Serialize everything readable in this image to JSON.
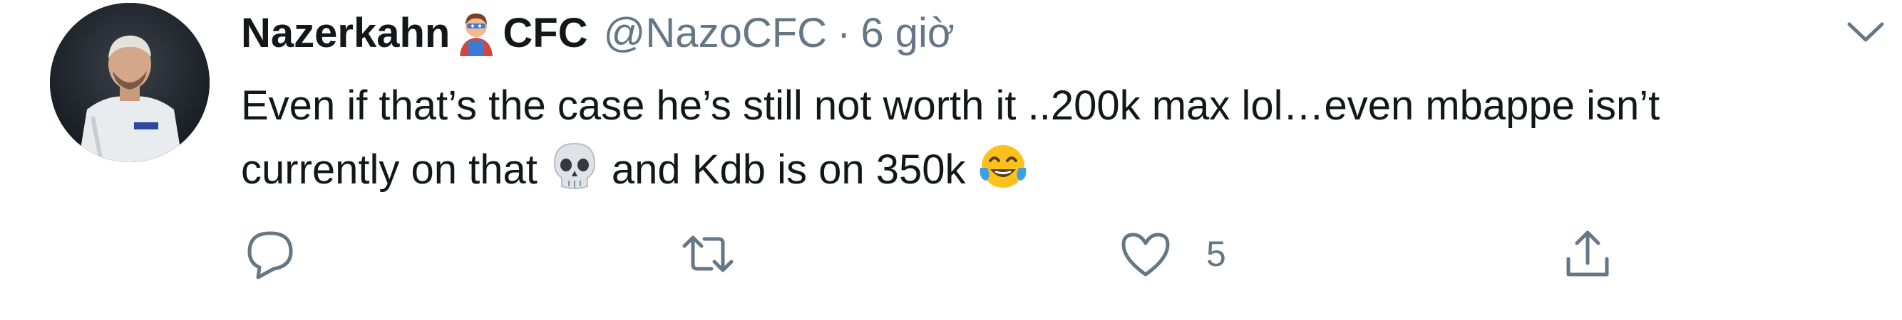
{
  "tweet": {
    "display_name_prefix": "Nazerkahn",
    "display_name_suffix": "CFC",
    "handle": "@NazoCFC",
    "separator": "·",
    "time": "6 giờ",
    "text_line1": "Even if that’s the case he’s still not worth it ..200k max lol…even mbappe isn’t",
    "text_line2_a": "currently on that",
    "text_line2_b": "and Kdb is on 350k",
    "name_emoji": "superhero-emoji",
    "inline_emoji_1": "skull-emoji",
    "inline_emoji_2": "tears-of-joy-emoji"
  },
  "actions": {
    "reply_icon": "reply-icon",
    "retweet_icon": "retweet-icon",
    "like_icon": "heart-icon",
    "like_count": "5",
    "share_icon": "share-icon"
  },
  "colors": {
    "text": "#14171a",
    "secondary": "#657786",
    "background": "#ffffff"
  }
}
